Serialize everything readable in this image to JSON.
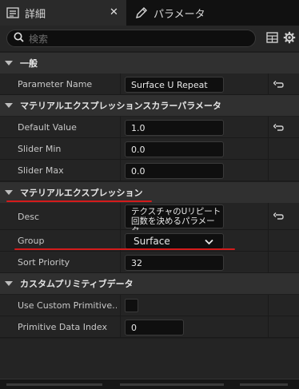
{
  "tabs": [
    {
      "label": "詳細",
      "icon": "details-list-icon",
      "active": true
    },
    {
      "label": "パラメータ",
      "icon": "pencil-icon",
      "active": false
    }
  ],
  "search": {
    "placeholder": "検索"
  },
  "sections": {
    "general": {
      "title": "一般",
      "rows": [
        {
          "label": "Parameter Name",
          "value": "Surface U Repeat"
        }
      ]
    },
    "scalar": {
      "title": "マテリアルエクスプレッションスカラーパラメータ",
      "rows": [
        {
          "label": "Default Value",
          "value": "1.0"
        },
        {
          "label": "Slider Min",
          "value": "0.0"
        },
        {
          "label": "Slider Max",
          "value": "0.0"
        }
      ]
    },
    "expression": {
      "title": "マテリアルエクスプレッション",
      "desc": {
        "label": "Desc",
        "value": "テクスチャのUリピート回数を決めるパラメータ"
      },
      "group": {
        "label": "Group",
        "value": "Surface"
      },
      "sort": {
        "label": "Sort Priority",
        "value": "32"
      }
    },
    "primitive": {
      "title": "カスタムプリミティブデータ",
      "use": {
        "label": "Use Custom Primitive…",
        "checked": false
      },
      "index": {
        "label": "Primitive Data Index",
        "value": "0"
      }
    }
  },
  "colors": {
    "accent_underline": "#d41b1b",
    "background": "#1e1e1e"
  }
}
